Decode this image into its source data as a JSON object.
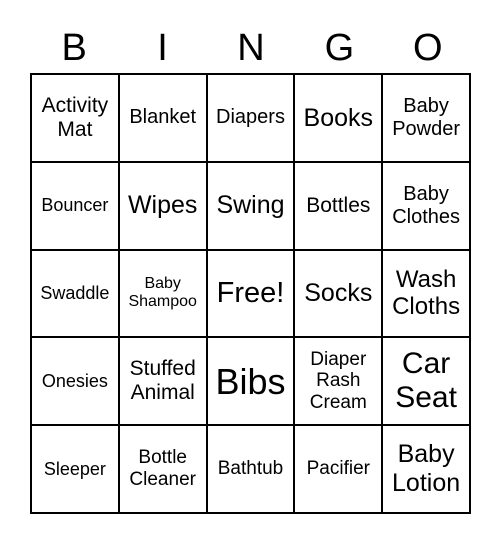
{
  "header": [
    "B",
    "I",
    "N",
    "G",
    "O"
  ],
  "cells": [
    "Activity Mat",
    "Blanket",
    "Diapers",
    "Books",
    "Baby Powder",
    "Bouncer",
    "Wipes",
    "Swing",
    "Bottles",
    "Baby Clothes",
    "Swaddle",
    "Baby Shampoo",
    "Free!",
    "Socks",
    "Wash Cloths",
    "Onesies",
    "Stuffed Animal",
    "Bibs",
    "Diaper Rash Cream",
    "Car Seat",
    "Sleeper",
    "Bottle Cleaner",
    "Bathtub",
    "Pacifier",
    "Baby Lotion"
  ]
}
